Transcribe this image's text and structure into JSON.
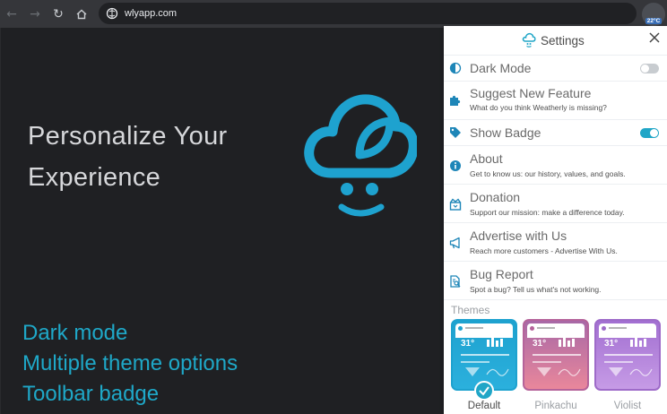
{
  "browser": {
    "url": "wlyapp.com",
    "extension_badge": "22°C"
  },
  "hero": {
    "headline_line1": "Personalize Your",
    "headline_line2": "Experience",
    "features": [
      "Dark mode",
      "Multiple theme options",
      "Toolbar badge"
    ]
  },
  "settings": {
    "title": "Settings",
    "items": [
      {
        "label": "Dark Mode",
        "toggle": false
      },
      {
        "label": "Suggest New Feature",
        "desc": "What do you think Weatherly is missing?"
      },
      {
        "label": "Show Badge",
        "toggle": true
      },
      {
        "label": "About",
        "desc": "Get to know us: our history, values, and goals."
      },
      {
        "label": "Donation",
        "desc": "Support our mission: make a difference today."
      },
      {
        "label": "Advertise with Us",
        "desc": "Reach more customers - Advertise With Us."
      },
      {
        "label": "Bug Report",
        "desc": "Spot a bug? Tell us what's not working."
      }
    ],
    "themes_label": "Themes",
    "themes": [
      {
        "name": "Default",
        "temp": "31°",
        "selected": true,
        "color": "#1ea2cf"
      },
      {
        "name": "Pinkachu",
        "temp": "31°",
        "selected": false,
        "color": "#b5639a"
      },
      {
        "name": "Violist",
        "temp": "31°",
        "selected": false,
        "color": "#9e6bc9"
      }
    ]
  },
  "colors": {
    "accent": "#20a6c7",
    "background": "#1f2023",
    "icon_blue": "#1e86b8"
  }
}
